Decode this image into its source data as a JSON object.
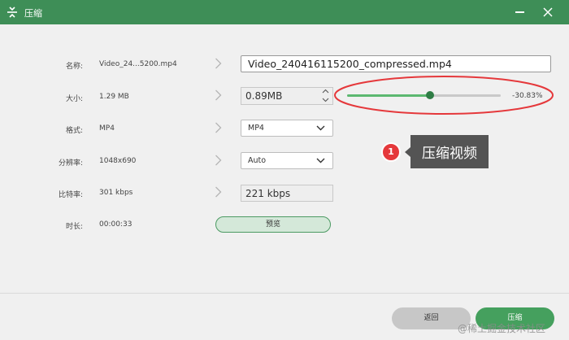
{
  "window": {
    "title": "压缩",
    "icon": "compress-app-icon",
    "controls": [
      "minimize-icon",
      "close-icon"
    ]
  },
  "form": {
    "name": {
      "label": "名称:",
      "original": "Video_24...5200.mp4",
      "output": "Video_240416115200_compressed.mp4"
    },
    "size": {
      "label": "大小:",
      "original": "1.29 MB",
      "output": "0.89MB"
    },
    "format": {
      "label": "格式:",
      "original": "MP4",
      "output": "MP4"
    },
    "resolution": {
      "label": "分辨率:",
      "original": "1048x690",
      "output": "Auto"
    },
    "bitrate": {
      "label": "比特率:",
      "original": "301 kbps",
      "output": "221 kbps"
    },
    "duration": {
      "label": "时长:",
      "original": "00:00:33"
    }
  },
  "preview_label": "预览",
  "compression": {
    "level": 0.54,
    "percent_text": "-30.83%"
  },
  "annotation": {
    "badge": "1",
    "callout": "压缩视频",
    "highlight_color": "#e5383b"
  },
  "footer": {
    "back_label": "返回",
    "compress_label": "压缩"
  },
  "watermark": "@稀土掘金技术社区",
  "colors": {
    "accent": "#3e8e57",
    "slider_fill": "#5cb870",
    "compress_button": "#45a05e"
  }
}
